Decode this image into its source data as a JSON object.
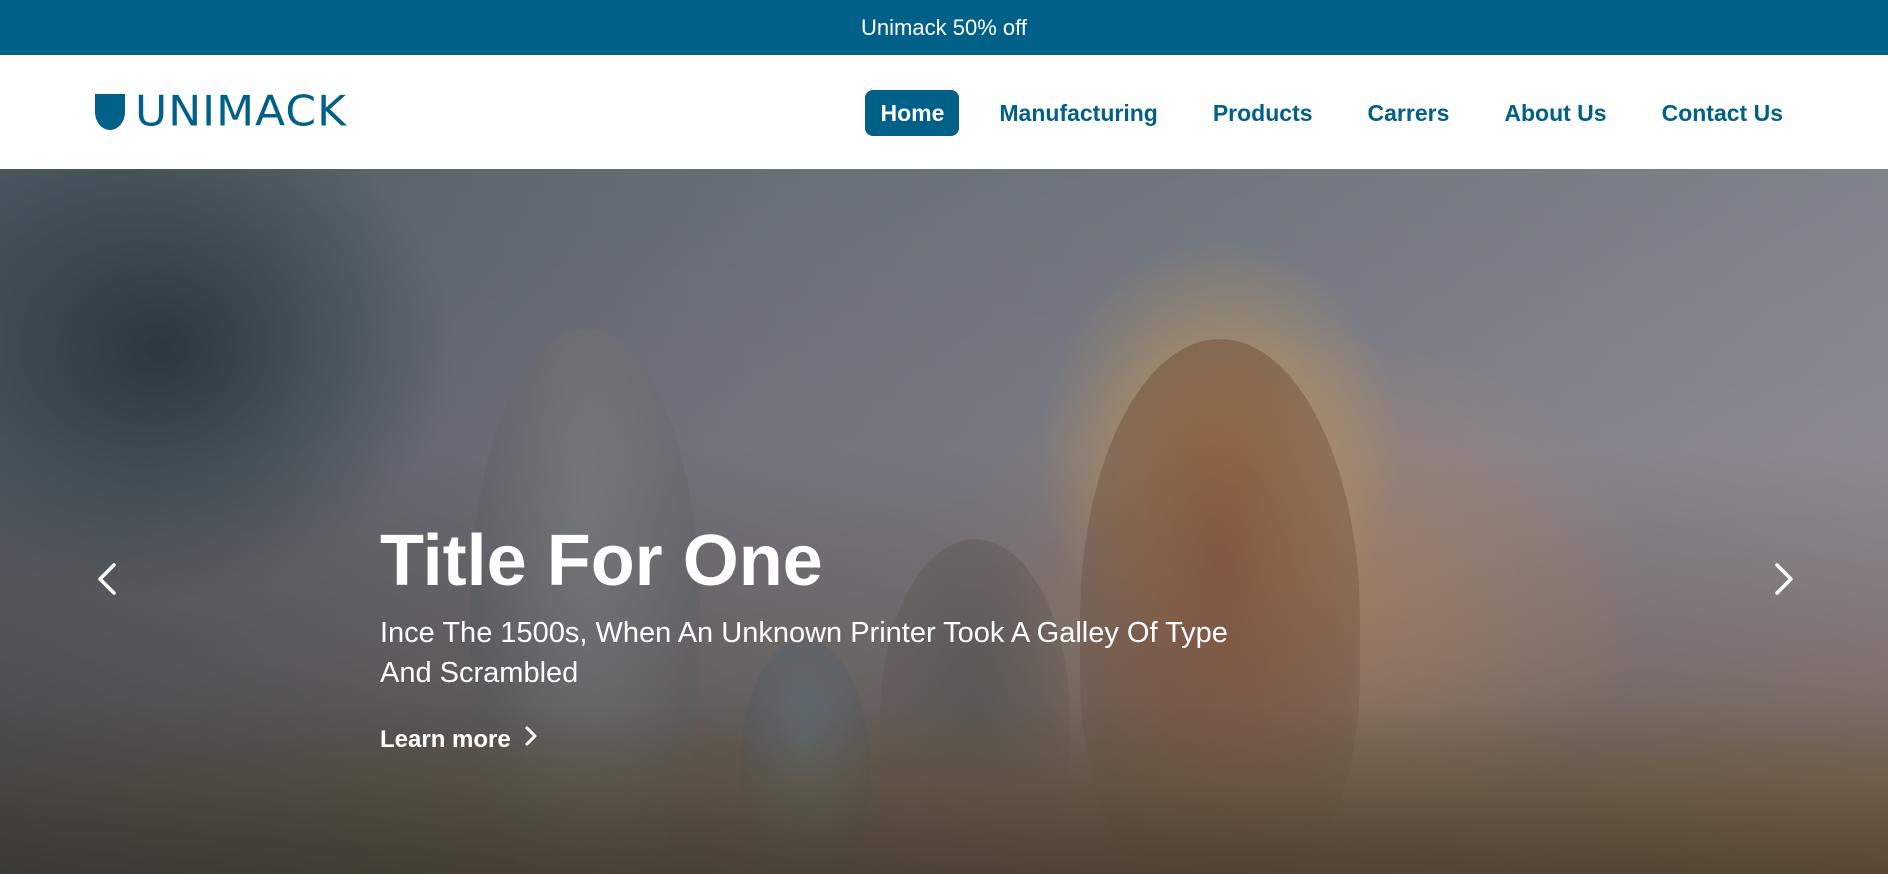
{
  "promo": {
    "text": "Unimack 50% off"
  },
  "brand": {
    "name": "UNIMACK",
    "color": "#006087"
  },
  "nav": {
    "items": [
      {
        "label": "Home",
        "active": true
      },
      {
        "label": "Manufacturing",
        "active": false
      },
      {
        "label": "Products",
        "active": false
      },
      {
        "label": "Carrers",
        "active": false
      },
      {
        "label": "About Us",
        "active": false
      },
      {
        "label": "Contact Us",
        "active": false
      }
    ]
  },
  "hero": {
    "title": "Title For One",
    "subtitle_line1": "Ince The 1500s, When An Unknown Printer Took A Galley Of Type",
    "subtitle_line2": "And Scrambled",
    "cta_label": "Learn more",
    "prev_icon": "chevron-left-icon",
    "next_icon": "chevron-right-icon"
  },
  "colors": {
    "primary": "#006087",
    "white": "#ffffff"
  }
}
